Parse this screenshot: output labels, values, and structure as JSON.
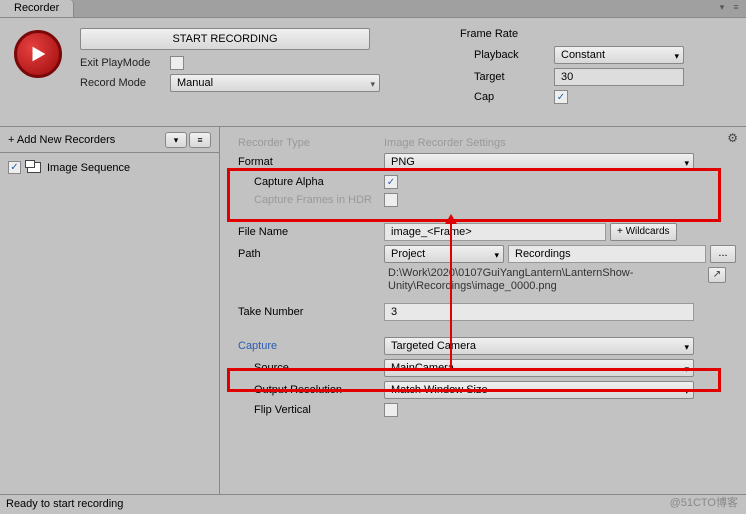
{
  "tab": "Recorder",
  "top": {
    "start_btn": "START RECORDING",
    "exit_playmode_lbl": "Exit PlayMode",
    "record_mode_lbl": "Record Mode",
    "record_mode_val": "Manual"
  },
  "framerate": {
    "title": "Frame Rate",
    "playback_lbl": "Playback",
    "playback_val": "Constant",
    "target_lbl": "Target",
    "target_val": "30",
    "cap_lbl": "Cap",
    "cap_checked": "✓"
  },
  "sidebar": {
    "add_lbl": "+ Add New Recorders",
    "item_label": "Image Sequence",
    "item_checked": "✓"
  },
  "settings": {
    "recorder_type_lbl": "Recorder Type",
    "recorder_type_val": "Image Recorder Settings",
    "format_lbl": "Format",
    "format_val": "PNG",
    "capture_alpha_lbl": "Capture Alpha",
    "capture_alpha_checked": "✓",
    "capture_hdr_lbl": "Capture Frames in HDR",
    "filename_lbl": "File Name",
    "filename_val": "image_<Frame>",
    "wildcards_btn": "+ Wildcards",
    "path_lbl": "Path",
    "path_scope": "Project",
    "path_val": "Recordings",
    "browse": "...",
    "fullpath": "D:\\Work\\2020\\0107GuiYangLantern\\LanternShow-Unity\\Recordings\\image_0000.png",
    "take_lbl": "Take Number",
    "take_val": "3",
    "capture_lbl": "Capture",
    "capture_val": "Targeted Camera",
    "source_lbl": "Source",
    "source_val": "MainCamera",
    "output_res_lbl": "Output Resolution",
    "output_res_val": "Match Window Size",
    "flip_lbl": "Flip Vertical"
  },
  "status": "Ready to start recording",
  "watermark": "@51CTO博客"
}
